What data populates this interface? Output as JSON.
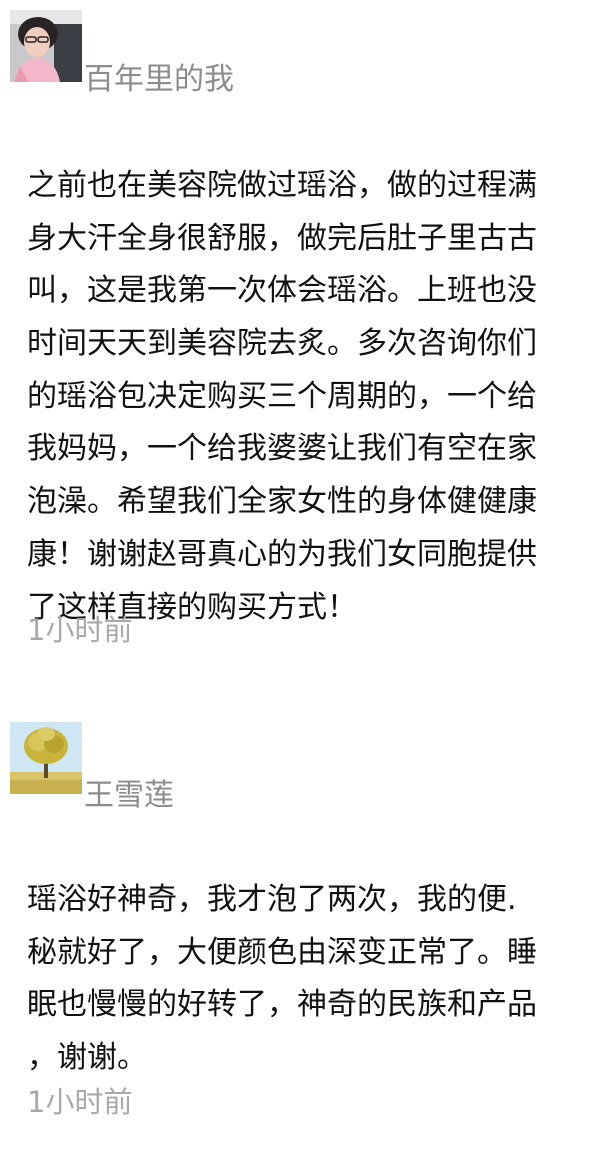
{
  "posts": [
    {
      "username": "百年里的我",
      "avatar_icon": "user-photo-avatar",
      "lines": [
        "之前也在美容院做过瑶浴，做的过程满",
        "身大汗全身很舒服，做完后肚子里古古",
        "叫，这是我第一次体会瑶浴。上班也没",
        "时间天天到美容院去炙。多次咨询你们",
        "的瑶浴包决定购买三个周期的，一个给",
        "我妈妈，一个给我婆婆让我们有空在家",
        "泡澡。希望我们全家女性的身体健健康",
        "康！谢谢赵哥真心的为我们女同胞提供",
        "了这样直接的购买方式！"
      ],
      "timestamp": "1小时前"
    },
    {
      "username": "王雪莲",
      "avatar_icon": "tree-photo-avatar",
      "lines": [
        "瑶浴好神奇，我才泡了两次，我的便.",
        "秘就好了，大便颜色由深变正常了。睡",
        "眠也慢慢的好转了，神奇的民族和产品",
        "，谢谢。"
      ],
      "timestamp": "1小时前"
    }
  ]
}
